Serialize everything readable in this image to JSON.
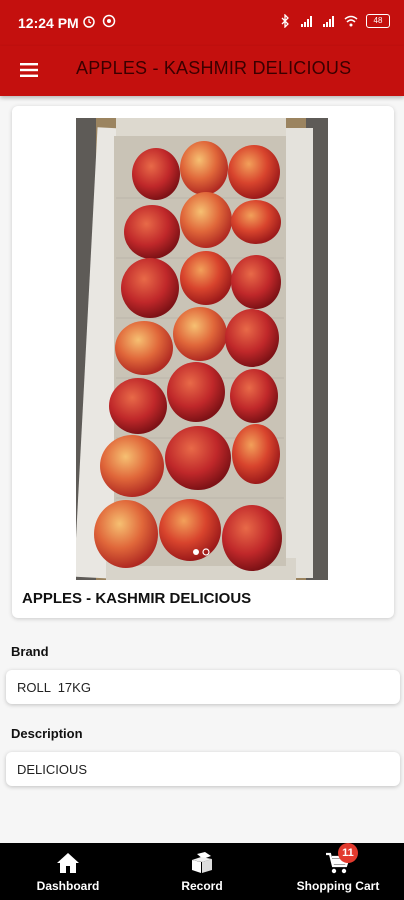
{
  "status_bar": {
    "time": "12:24 PM",
    "battery": "48",
    "left_icons": [
      "alarm-icon",
      "headset-icon"
    ],
    "right_icons": [
      "bluetooth-icon",
      "signal-icon",
      "volte-icon",
      "wifi-icon",
      "battery-icon"
    ]
  },
  "app_bar": {
    "title": "APPLES - KASHMIR DELICIOUS",
    "menu_icon": "hamburger-menu-icon"
  },
  "product": {
    "title": "APPLES - KASHMIR DELICIOUS",
    "image_pages": 2,
    "current_page": 1
  },
  "brand": {
    "label": "Brand",
    "value": "ROLL  17KG"
  },
  "description": {
    "label": "Description",
    "value": "DELICIOUS"
  },
  "bottom_nav": {
    "items": [
      {
        "label": "Dashboard",
        "icon": "home-icon"
      },
      {
        "label": "Record",
        "icon": "boxes-icon"
      },
      {
        "label": "Shopping Cart",
        "icon": "cart-icon",
        "badge": "11"
      }
    ]
  },
  "colors": {
    "primary": "#c4100e",
    "title_text": "#3b0000",
    "nav_bg": "#000000",
    "badge": "#e23a2e"
  }
}
